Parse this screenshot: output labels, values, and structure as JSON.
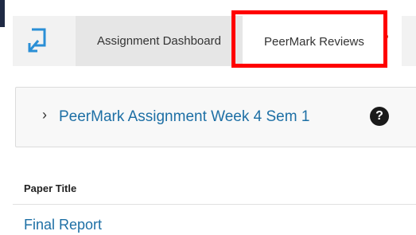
{
  "header": {
    "app_icon": "turnitin-return-icon",
    "tabs": [
      {
        "label": "Assignment Dashboard"
      },
      {
        "label": "PeerMark Reviews",
        "has_notification": true
      }
    ]
  },
  "assignment": {
    "title": "PeerMark Assignment Week 4 Sem 1",
    "expand_icon": "chevron-right-icon",
    "help_icon": "question-mark"
  },
  "table": {
    "columns": [
      "Paper Title"
    ],
    "rows": [
      {
        "paper_title": "Final Report"
      }
    ]
  },
  "colors": {
    "link": "#1d6fa5",
    "highlight": "#ff0000",
    "notification_dot": "#c23b22",
    "icon_blue": "#2a8fd6"
  }
}
